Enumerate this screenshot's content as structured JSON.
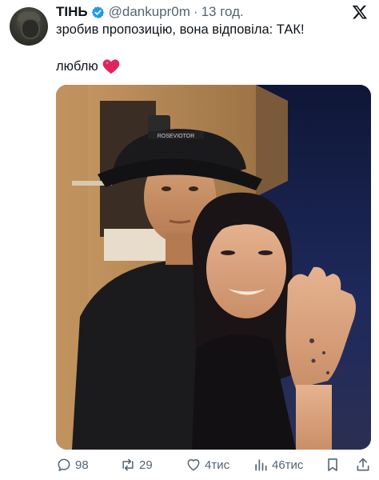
{
  "tweet": {
    "display_name": "ТІНЬ",
    "handle": "@dankupr0m",
    "separator": "·",
    "time": "13 год.",
    "text_line1": "зробив пропозицію, вона відповіла: ТАК!",
    "text_line2": "люблю"
  },
  "photo": {
    "hat_text": "ROSEVIOTOR"
  },
  "actions": {
    "replies": "98",
    "retweets": "29",
    "likes": "4тис",
    "views": "46тис"
  },
  "colors": {
    "verified": "#1d9bf0",
    "secondary_text": "#536471",
    "heart": "#e0245e"
  }
}
